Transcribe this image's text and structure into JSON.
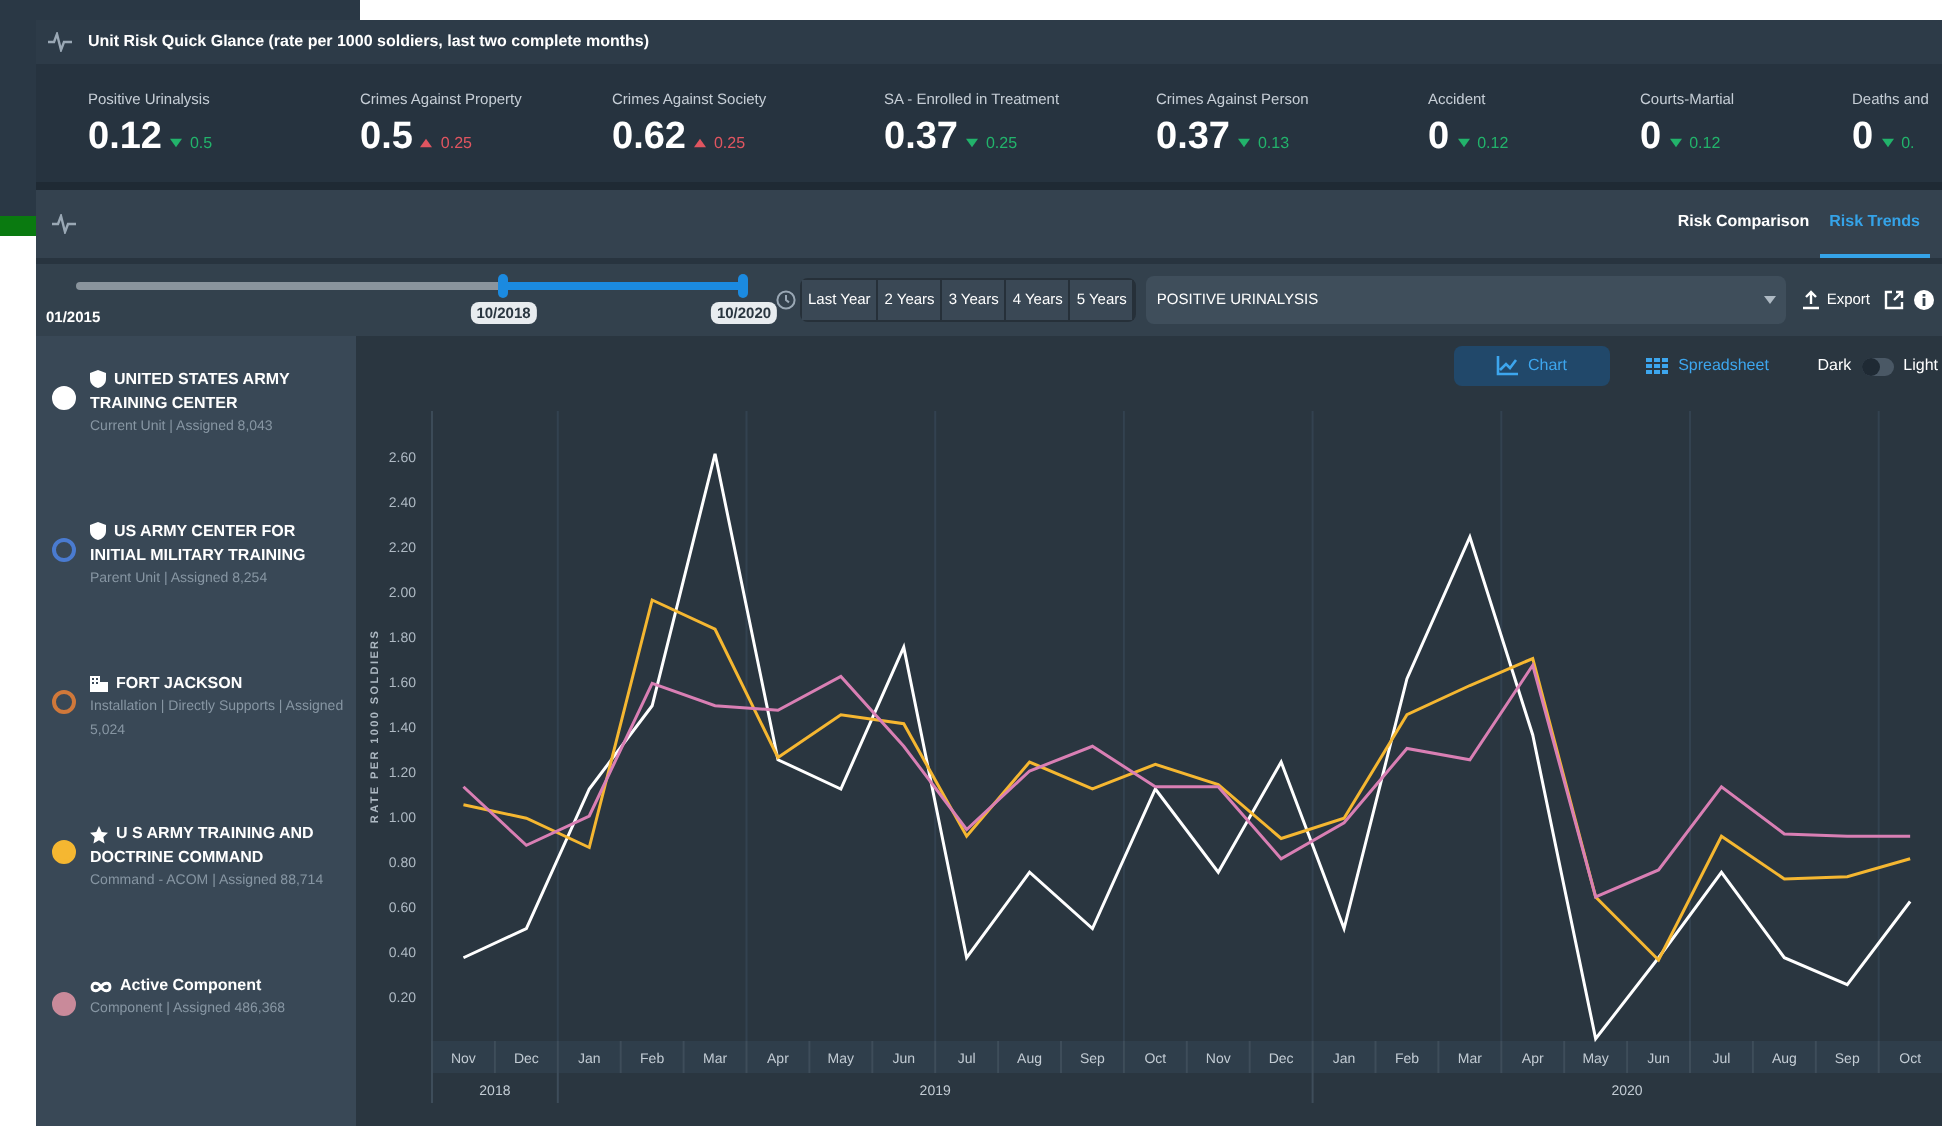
{
  "header": {
    "title": "Unit Risk Quick Glance (rate per 1000 soldiers, last two complete months)"
  },
  "kpis": [
    {
      "label": "Positive Urinalysis",
      "value": "0.12",
      "up": false,
      "delta": "0.5"
    },
    {
      "label": "Crimes Against Property",
      "value": "0.5",
      "up": true,
      "delta": "0.25"
    },
    {
      "label": "Crimes Against Society",
      "value": "0.62",
      "up": true,
      "delta": "0.25"
    },
    {
      "label": "SA - Enrolled in Treatment",
      "value": "0.37",
      "up": false,
      "delta": "0.25"
    },
    {
      "label": "Crimes Against Person",
      "value": "0.37",
      "up": false,
      "delta": "0.13"
    },
    {
      "label": "Accident",
      "value": "0",
      "up": false,
      "delta": "0.12"
    },
    {
      "label": "Courts-Martial",
      "value": "0",
      "up": false,
      "delta": "0.12"
    },
    {
      "label": "Deaths and",
      "value": "0",
      "up": false,
      "delta": "0."
    }
  ],
  "tabs": [
    {
      "label": "Risk Comparison",
      "selected": false
    },
    {
      "label": "Risk Trends",
      "selected": true
    }
  ],
  "slider": {
    "min_label": "01/2015",
    "handles": [
      {
        "label": "10/2018",
        "level": 0.64
      },
      {
        "label": "10/2020",
        "level": 1
      }
    ]
  },
  "ranges": [
    {
      "label": "Last Year"
    },
    {
      "label": "2 Years"
    },
    {
      "label": "3 Years"
    },
    {
      "label": "4 Years"
    },
    {
      "label": "5 Years"
    }
  ],
  "measure_select": {
    "value": "POSITIVE URINALYSIS"
  },
  "export_label": "Export",
  "views": [
    {
      "label": "Chart",
      "kind": "chart",
      "selected": true
    },
    {
      "label": "Spreadsheet",
      "kind": "table",
      "selected": false
    }
  ],
  "theme_toggle": {
    "off_label": "Dark",
    "on_label": "Light",
    "on": false
  },
  "legend": [
    {
      "kind": "unit",
      "name": "UNITED STATES ARMY TRAINING CENTER",
      "detail": "Current Unit | Assigned 8,043",
      "color": "#ffffff",
      "filled": true
    },
    {
      "kind": "unit",
      "name": "US ARMY CENTER FOR INITIAL MILITARY TRAINING",
      "detail": "Parent Unit | Assigned 8,254",
      "color": "#4a7bd0",
      "filled": false
    },
    {
      "kind": "installation",
      "name": "FORT JACKSON",
      "detail": "Installation | Directly Supports | Assigned 5,024",
      "color": "#d0783a",
      "filled": false
    },
    {
      "kind": "command",
      "name": "U S ARMY TRAINING AND DOCTRINE COMMAND",
      "detail": "Command - ACOM | Assigned 88,714",
      "color": "#f5b731",
      "filled": true
    },
    {
      "kind": "component",
      "name": "Active Component",
      "detail": "Component | Assigned 486,368",
      "color": "#c98a9a",
      "filled": true
    }
  ],
  "chart_data": {
    "type": "line",
    "ylabel": "RATE PER 1000 SOLDIERS",
    "categories": [
      "Nov",
      "Dec",
      "Jan",
      "Feb",
      "Mar",
      "Apr",
      "May",
      "Jun",
      "Jul",
      "Aug",
      "Sep",
      "Oct",
      "Nov",
      "Dec",
      "Jan",
      "Feb",
      "Mar",
      "Apr",
      "May",
      "Jun",
      "Jul",
      "Aug",
      "Sep",
      "Oct"
    ],
    "annotations": [
      "2018",
      "2019",
      "2020"
    ],
    "ylim": [
      0,
      2.8
    ],
    "yticks": [
      {
        "value": 0.2,
        "label": "0.20"
      },
      {
        "value": 0.4,
        "label": "0.40"
      },
      {
        "value": 0.6,
        "label": "0.60"
      },
      {
        "value": 0.8,
        "label": "0.80"
      },
      {
        "value": 1.0,
        "label": "1.00"
      },
      {
        "value": 1.2,
        "label": "1.20"
      },
      {
        "value": 1.4,
        "label": "1.40"
      },
      {
        "value": 1.6,
        "label": "1.60"
      },
      {
        "value": 1.8,
        "label": "1.80"
      },
      {
        "value": 2.0,
        "label": "2.00"
      },
      {
        "value": 2.2,
        "label": "2.20"
      },
      {
        "value": 2.4,
        "label": "2.40"
      },
      {
        "value": 2.6,
        "label": "2.60"
      }
    ],
    "series": [
      {
        "color": "#ffffff",
        "values": [
          0.37,
          0.5,
          1.12,
          1.49,
          2.61,
          1.25,
          1.12,
          1.75,
          0.37,
          0.75,
          0.5,
          1.12,
          0.75,
          1.24,
          0.5,
          1.61,
          2.24,
          1.36,
          0.01,
          0.37,
          0.75,
          0.37,
          0.25,
          0.62
        ]
      },
      {
        "color": "#f5b731",
        "values": [
          1.05,
          0.99,
          0.86,
          1.96,
          1.83,
          1.26,
          1.45,
          1.41,
          0.91,
          1.24,
          1.12,
          1.23,
          1.14,
          0.9,
          0.99,
          1.45,
          1.58,
          1.7,
          0.64,
          0.36,
          0.91,
          0.72,
          0.73,
          0.81
        ]
      },
      {
        "color": "#d97fb4",
        "values": [
          1.13,
          0.87,
          1.0,
          1.59,
          1.49,
          1.47,
          1.62,
          1.31,
          0.94,
          1.2,
          1.31,
          1.13,
          1.13,
          0.81,
          0.97,
          1.3,
          1.25,
          1.67,
          0.64,
          0.76,
          1.13,
          0.92,
          0.91,
          0.91
        ]
      }
    ]
  }
}
